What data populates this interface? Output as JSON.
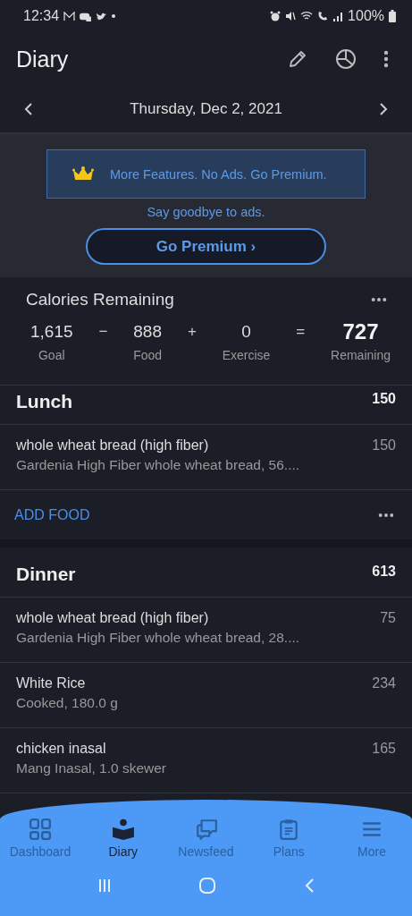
{
  "status_bar": {
    "time": "12:34",
    "battery": "100%"
  },
  "app_bar": {
    "title": "Diary"
  },
  "date_nav": {
    "date": "Thursday, Dec 2, 2021"
  },
  "premium": {
    "banner": "More Features. No Ads. Go Premium.",
    "subtitle": "Say goodbye to ads.",
    "button": "Go Premium ›"
  },
  "calories": {
    "title": "Calories Remaining",
    "terms": [
      {
        "value": "1,615",
        "label": "Goal",
        "kind": "term"
      },
      {
        "value": "−",
        "kind": "operator"
      },
      {
        "value": "888",
        "label": "Food",
        "kind": "term"
      },
      {
        "value": "+",
        "kind": "operator"
      },
      {
        "value": "0",
        "label": "Exercise",
        "kind": "term"
      },
      {
        "value": "=",
        "kind": "operator"
      },
      {
        "value": "727",
        "label": "Remaining",
        "kind": "result"
      }
    ]
  },
  "meals": [
    {
      "name": "Lunch",
      "total": "150",
      "add_food": "ADD FOOD",
      "items": [
        {
          "name": "whole wheat bread (high fiber)",
          "detail": "Gardenia High Fiber whole wheat bread, 56....",
          "calories": "150"
        }
      ]
    },
    {
      "name": "Dinner",
      "total": "613",
      "items": [
        {
          "name": "whole wheat bread (high fiber)",
          "detail": "Gardenia High Fiber whole wheat bread, 28....",
          "calories": "75"
        },
        {
          "name": "White Rice",
          "detail": "Cooked, 180.0 g",
          "calories": "234"
        },
        {
          "name": "chicken inasal",
          "detail": "Mang  Inasal, 1.0 skewer",
          "calories": "165"
        }
      ]
    }
  ],
  "bottom_nav": [
    {
      "label": "Dashboard",
      "kind": "grid",
      "selected": false
    },
    {
      "label": "Diary",
      "kind": "book",
      "selected": true
    },
    {
      "label": "Newsfeed",
      "kind": "chat",
      "selected": false
    },
    {
      "label": "Plans",
      "kind": "clipboard",
      "selected": false
    },
    {
      "label": "More",
      "kind": "menu",
      "selected": false
    }
  ]
}
